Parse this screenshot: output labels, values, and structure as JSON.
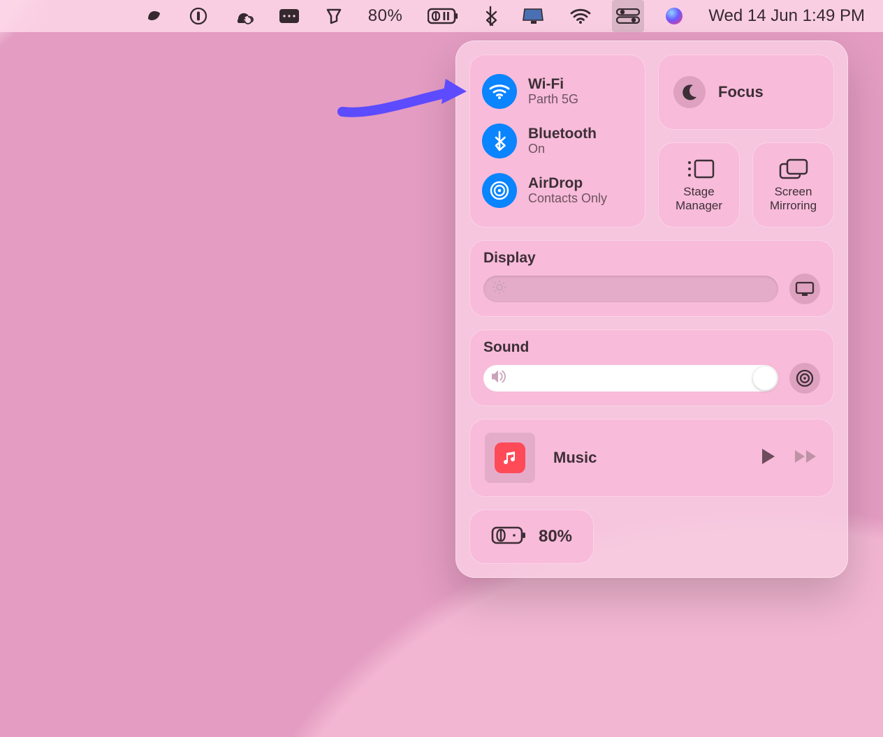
{
  "menubar": {
    "battery_percent": "80%",
    "datetime": "Wed 14 Jun  1:49 PM"
  },
  "control_center": {
    "connectivity": {
      "wifi": {
        "title": "Wi-Fi",
        "subtitle": "Parth 5G"
      },
      "bluetooth": {
        "title": "Bluetooth",
        "subtitle": "On"
      },
      "airdrop": {
        "title": "AirDrop",
        "subtitle": "Contacts Only"
      }
    },
    "focus": {
      "label": "Focus"
    },
    "stage_manager": {
      "label": "Stage Manager"
    },
    "screen_mirroring": {
      "label": "Screen Mirroring"
    },
    "display": {
      "title": "Display"
    },
    "sound": {
      "title": "Sound"
    },
    "music": {
      "title": "Music"
    },
    "battery": {
      "percent": "80%"
    }
  }
}
